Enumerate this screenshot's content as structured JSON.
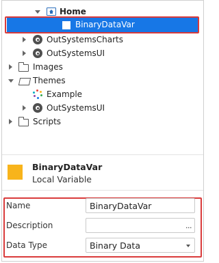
{
  "tree": {
    "items": [
      {
        "label": "Home",
        "icon": "screen-icon",
        "expanded": true
      },
      {
        "label": "BinaryDataVar",
        "icon": "variable-icon",
        "selected": true
      },
      {
        "label": "OutSystemsCharts",
        "icon": "module-icon",
        "expanded": false
      },
      {
        "label": "OutSystemsUI",
        "icon": "module-icon",
        "expanded": false
      },
      {
        "label": "Images",
        "icon": "folder-icon",
        "expanded": false
      },
      {
        "label": "Themes",
        "icon": "folder-open-icon",
        "expanded": true
      },
      {
        "label": "Example",
        "icon": "theme-icon"
      },
      {
        "label": "OutSystemsUI",
        "icon": "module-icon",
        "expanded": false
      },
      {
        "label": "Scripts",
        "icon": "folder-icon",
        "expanded": false
      }
    ]
  },
  "detail": {
    "name": "BinaryDataVar",
    "type": "Local Variable",
    "accent_color": "#f8b41b"
  },
  "properties": {
    "name_label": "Name",
    "name_value": "BinaryDataVar",
    "description_label": "Description",
    "description_value": "",
    "description_button": "...",
    "data_type_label": "Data Type",
    "data_type_value": "Binary Data"
  },
  "colors": {
    "selection": "#1777e6",
    "highlight_outline": "#d93a3a"
  }
}
